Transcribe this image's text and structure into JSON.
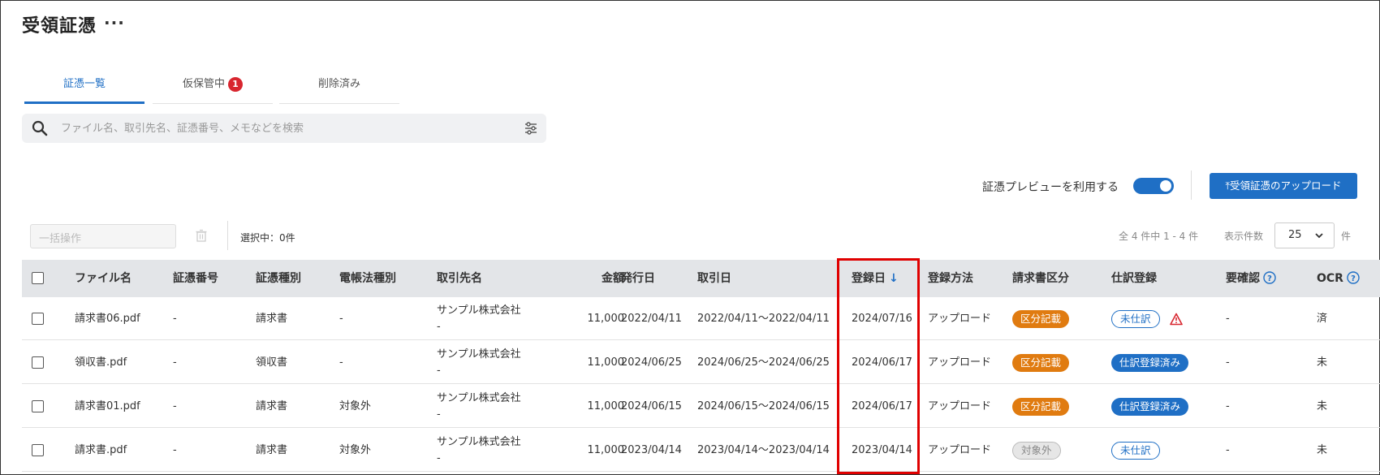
{
  "page": {
    "title": "受領証憑",
    "more": "···"
  },
  "tabs": [
    {
      "label": "証憑一覧",
      "active": true
    },
    {
      "label": "仮保管中",
      "badge": "1"
    },
    {
      "label": "削除済み"
    }
  ],
  "search": {
    "placeholder": "ファイル名、取引先名、証憑番号、メモなどを検索"
  },
  "toolbar": {
    "preview_label": "証憑プレビューを利用する",
    "preview_enabled": true,
    "upload_label": "⤒受領証憑のアップロード",
    "bulk_placeholder": "一括操作",
    "selected_text": "選択中：0件",
    "range_text": "全 4 件中 1 - 4 件",
    "perpage_label": "表示件数",
    "perpage_value": "25",
    "perpage_unit": "件"
  },
  "table": {
    "headers": {
      "filename": "ファイル名",
      "number": "証憑番号",
      "type": "証憑種別",
      "ebook": "電帳法種別",
      "vendor": "取引先名",
      "amount": "金額",
      "issue_date": "発行日",
      "trade_date": "取引日",
      "reg_date": "登録日",
      "reg_method": "登録方法",
      "invoice_class": "請求書区分",
      "journal": "仕訳登録",
      "confirm": "要確認",
      "ocr": "OCR"
    },
    "rows": [
      {
        "filename": "請求書06.pdf",
        "number": "-",
        "type": "請求書",
        "ebook": "-",
        "vendor": "サンプル株式会社",
        "vendor_sub": "-",
        "amount": "11,000",
        "issue_date": "2022/04/11",
        "trade_date": "2022/04/11〜2022/04/11",
        "reg_date": "2024/07/16",
        "reg_method": "アップロード",
        "invoice_class": "区分記載",
        "journal": "未仕訳",
        "confirm": "-",
        "ocr": "済"
      },
      {
        "filename": "領収書.pdf",
        "number": "-",
        "type": "領収書",
        "ebook": "-",
        "vendor": "サンプル株式会社",
        "vendor_sub": "-",
        "amount": "11,000",
        "issue_date": "2024/06/25",
        "trade_date": "2024/06/25〜2024/06/25",
        "reg_date": "2024/06/17",
        "reg_method": "アップロード",
        "invoice_class": "区分記載",
        "journal": "仕訳登録済み",
        "confirm": "-",
        "ocr": "未"
      },
      {
        "filename": "請求書01.pdf",
        "number": "-",
        "type": "請求書",
        "ebook": "対象外",
        "vendor": "サンプル株式会社",
        "vendor_sub": "-",
        "amount": "11,000",
        "issue_date": "2024/06/15",
        "trade_date": "2024/06/15〜2024/06/15",
        "reg_date": "2024/06/17",
        "reg_method": "アップロード",
        "invoice_class": "区分記載",
        "journal": "仕訳登録済み",
        "confirm": "-",
        "ocr": "未"
      },
      {
        "filename": "請求書.pdf",
        "number": "-",
        "type": "請求書",
        "ebook": "対象外",
        "vendor": "サンプル株式会社",
        "vendor_sub": "-",
        "amount": "11,000",
        "issue_date": "2023/04/14",
        "trade_date": "2023/04/14〜2023/04/14",
        "reg_date": "2023/04/14",
        "reg_method": "アップロード",
        "invoice_class": "対象外",
        "journal": "未仕訳",
        "confirm": "-",
        "ocr": "未"
      }
    ]
  },
  "colors": {
    "accent": "#1f6fc5",
    "badge_red": "#d8262f",
    "orange": "#e07b10",
    "highlight": "#e00000"
  }
}
